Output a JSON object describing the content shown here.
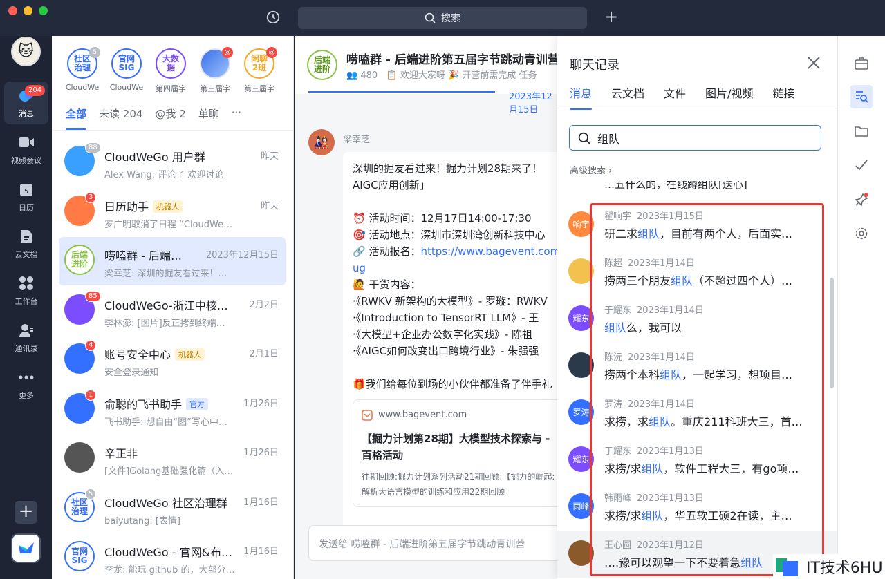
{
  "titlebar": {
    "search_label": "搜索"
  },
  "sidebar": {
    "messages_badge": "204",
    "items": [
      {
        "label": "消息"
      },
      {
        "label": "视频会议"
      },
      {
        "label": "日历"
      },
      {
        "label": "云文档"
      },
      {
        "label": "工作台"
      },
      {
        "label": "通讯录"
      },
      {
        "label": "更多"
      }
    ]
  },
  "pinned": [
    {
      "avatar": "社区\n治理",
      "label": "CloudWe",
      "badge": "5",
      "color": "#3370ff"
    },
    {
      "avatar": "官网\nSIG",
      "label": "CloudWe",
      "badge": "",
      "color": "#3370ff"
    },
    {
      "avatar": "大数\n据",
      "label": "第四届字",
      "badge": "",
      "color": "#7b4dff"
    },
    {
      "avatar": "",
      "label": "第三届字",
      "badge": "@",
      "color": "#3370ff"
    },
    {
      "avatar": "闲聊\n2班",
      "label": "第三届字",
      "badge": "@",
      "color": "#f5a623"
    }
  ],
  "list_tabs": [
    "全部",
    "未读 204",
    "@我 2",
    "单聊",
    "···"
  ],
  "chats": [
    {
      "name": "CloudWeGo 用户群",
      "tag": "",
      "time": "昨天",
      "preview": "Alex Wang: 评论了 欢迎讨论",
      "badge": "88",
      "avatar": "",
      "color": "#3aa0ff"
    },
    {
      "name": "日历助手",
      "tag": "机器人",
      "time": "昨天",
      "preview": "罗广明取消了日程 “CloudWe…",
      "badge": "3",
      "avatar": "",
      "color": "#ff7a45"
    },
    {
      "name": "唠嗑群 - 后端…",
      "tag": "",
      "time": "2023年12月15日",
      "preview": "梁幸芝: 深圳的掘友看过来！…",
      "badge": "",
      "avatar": "后端\n进阶",
      "color": "#8bc34a"
    },
    {
      "name": "CloudWeGo-浙江中核…",
      "tag": "",
      "time": "2月2日",
      "preview": "李林澎: [图片]反正拷到终端…",
      "badge": "85",
      "avatar": "",
      "color": "#7b4dff"
    },
    {
      "name": "账号安全中心",
      "tag": "机器人",
      "time": "2月1日",
      "preview": "安全登录通知",
      "badge": "4",
      "avatar": "",
      "color": "#3370ff"
    },
    {
      "name": "俞聪的飞书助手",
      "tag": "官方",
      "time": "1月26日",
      "preview": "飞书助手: 想自由“图”写心中…",
      "badge": "1",
      "avatar": "",
      "color": "#3370ff"
    },
    {
      "name": "辛正非",
      "tag": "",
      "time": "1月26日",
      "preview": "[文件]Golang基础强化篇（入…",
      "badge": "",
      "avatar": "",
      "color": "#555"
    },
    {
      "name": "CloudWeGo 社区治理群",
      "tag": "",
      "time": "1月16日",
      "preview": "baiyutang: [表情]",
      "badge": "5",
      "avatar": "社区\n治理",
      "color": "#3370ff"
    },
    {
      "name": "CloudWeGo - 官网&布…",
      "tag": "",
      "time": "1月16日",
      "preview": "李龙: 能玩 github 的，大部分…",
      "badge": "",
      "avatar": "官网\nSIG",
      "color": "#3370ff"
    }
  ],
  "chat": {
    "group_avatar": "后端\n进阶",
    "title": "唠嗑群 - 后端进阶第五届字节跳动青训营",
    "members": "480",
    "notice": "欢迎大家呀 🎉 开营前需完成 任务",
    "date": "2023年12月15日",
    "sender": "梁幸芝",
    "message_lines": [
      "深圳的掘友看过来！掘力计划28期来了！",
      "AIGC应用创新」",
      "",
      "⏰ 活动时间：12月17日14:00-17:30",
      "🎯 活动地点：深圳市深圳湾创新科技中心",
      "🔗 活动报名：https://www.bagevent.com/event/",
      "ug",
      "🙋 干货内容：",
      "·《RWKV 新架构的大模型》- 罗璇：RWKV",
      "·《Introduction to TensorRT LLM》- 王",
      "·《大模型+企业办公数字化实践》- 陈祖",
      "·《AIGC如何改变出口跨境行业》- 朱强强",
      "",
      "🎁我们给每位到场的小伙伴都准备了伴手礼"
    ],
    "link_url": "https://www.bagevent.com/event/",
    "card_domain": "www.bagevent.com",
    "card_title": "【掘力计划第28期】大模型技术探索与 - 百格活动",
    "card_desc": "往期回顾:掘力计划系列活动21期回顾:【掘力的崛起:解析大语言模型的训练和应用22期回顾",
    "composer_placeholder": "发送给 唠嗑群 - 后端进阶第五届字节跳动青训营"
  },
  "history": {
    "title": "聊天记录",
    "tabs": [
      "消息",
      "云文档",
      "文件",
      "图片/视频",
      "链接"
    ],
    "search_value": "组队",
    "advanced": "高级搜索",
    "partial_top": "…五什么的，在线蹲组队[送心]",
    "keyword": "组队",
    "results": [
      {
        "name": "翟响宇",
        "date": "2023年1月15日",
        "before": "研二求",
        "after": "，目前有两个人，后面实…",
        "avatar": "响宇",
        "color": "#ff8a3d"
      },
      {
        "name": "陈超",
        "date": "2023年1月14日",
        "before": "捞两三个朋友",
        "after": "（不超过四个人）…",
        "avatar": "",
        "color": "#f2c14e"
      },
      {
        "name": "于耀东",
        "date": "2023年1月14日",
        "before": "",
        "after": "么，我可以",
        "avatar": "耀东",
        "color": "#7b4dff"
      },
      {
        "name": "陈沅",
        "date": "2023年1月14日",
        "before": "捞两个本科",
        "after": "，一起学习，想项目…",
        "avatar": "",
        "color": "#2b3a4a"
      },
      {
        "name": "罗涛",
        "date": "2023年1月14日",
        "before": "求捞，求",
        "after": "。重庆211科班大三，首…",
        "avatar": "罗涛",
        "color": "#3370ff"
      },
      {
        "name": "于耀东",
        "date": "2023年1月13日",
        "before": "求捞/求",
        "after": "，软件工程大三，有go项…",
        "avatar": "耀东",
        "color": "#7b4dff"
      },
      {
        "name": "韩雨峰",
        "date": "2023年1月13日",
        "before": "求捞/求",
        "after": "，华五软工硕2在读，主…",
        "avatar": "雨峰",
        "color": "#3370ff"
      },
      {
        "name": "王心圆",
        "date": "2023年1月12日",
        "before": "….豫可以观望一下不要着急",
        "after": "",
        "avatar": "",
        "color": "#8b5a2b"
      }
    ]
  },
  "watermark": "IT技术6HU"
}
